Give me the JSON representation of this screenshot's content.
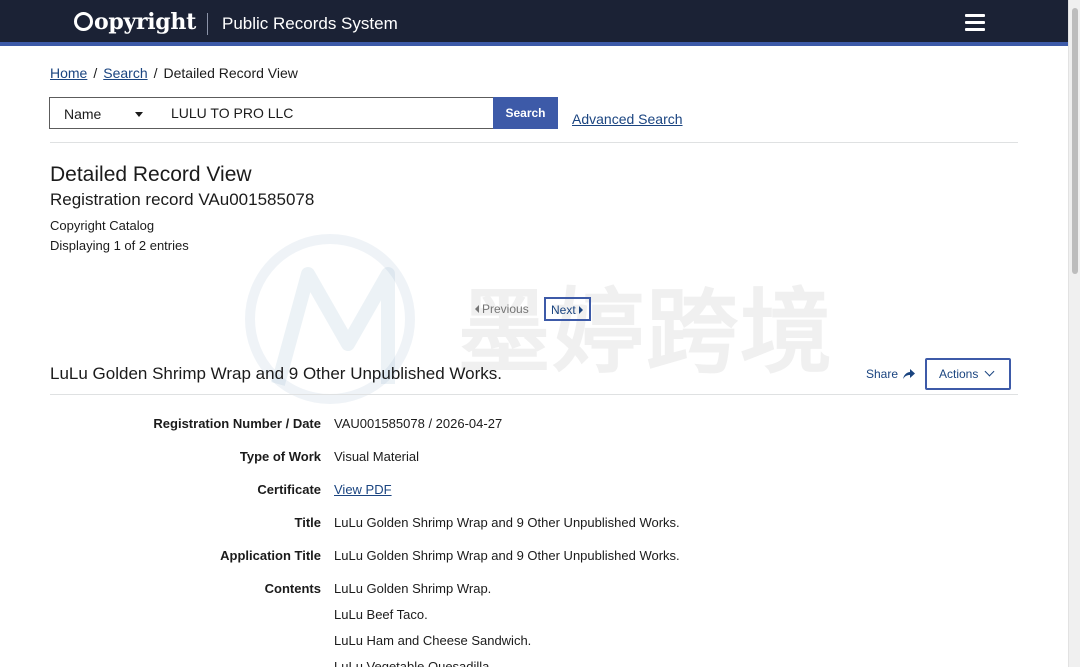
{
  "header": {
    "logo_text": "opyright",
    "app_name": "Public Records System"
  },
  "breadcrumb": {
    "home": "Home",
    "search": "Search",
    "current": "Detailed Record View",
    "separator": "/"
  },
  "search": {
    "type_selected": "Name",
    "query": "LULU TO PRO LLC",
    "button": "Search",
    "advanced": "Advanced Search"
  },
  "page": {
    "title": "Detailed Record View",
    "subtitle": "Registration record VAu001585078",
    "catalog": "Copyright Catalog",
    "displaying": "Displaying 1 of 2 entries"
  },
  "pager": {
    "previous": "Previous",
    "next": "Next"
  },
  "record": {
    "title": "LuLu Golden Shrimp Wrap and 9 Other Unpublished Works.",
    "share": "Share",
    "actions": "Actions",
    "fields": {
      "reg_label": "Registration Number / Date",
      "reg_value": "VAU001585078 / 2026-04-27",
      "type_label": "Type of Work",
      "type_value": "Visual Material",
      "cert_label": "Certificate",
      "cert_value": "View PDF",
      "title_label": "Title",
      "title_value": "LuLu Golden Shrimp Wrap and 9 Other Unpublished Works.",
      "app_title_label": "Application Title",
      "app_title_value": "LuLu Golden Shrimp Wrap and 9 Other Unpublished Works.",
      "contents_label": "Contents"
    },
    "contents": [
      "LuLu Golden Shrimp Wrap.",
      "LuLu Beef Taco.",
      "LuLu Ham and Cheese Sandwich.",
      "LuLu Vegetable Quesadilla."
    ]
  },
  "watermark": {
    "text": "墨婷跨境"
  },
  "colors": {
    "header_bg": "#1b2235",
    "accent": "#3d5aa8",
    "link": "#1a4480"
  }
}
